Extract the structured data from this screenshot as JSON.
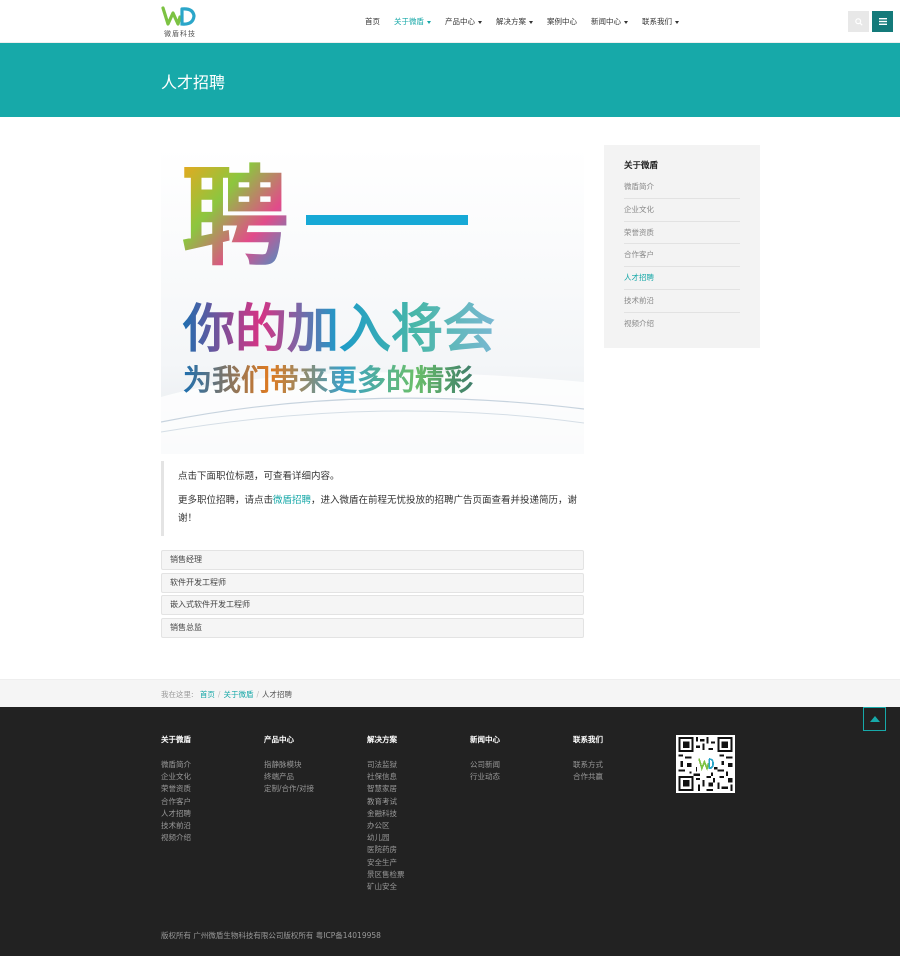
{
  "header": {
    "logo_text": "微盾科技",
    "nav": [
      {
        "label": "首页",
        "active": false,
        "dropdown": false
      },
      {
        "label": "关于微盾",
        "active": true,
        "dropdown": true
      },
      {
        "label": "产品中心",
        "active": false,
        "dropdown": true
      },
      {
        "label": "解决方案",
        "active": false,
        "dropdown": true
      },
      {
        "label": "案例中心",
        "active": false,
        "dropdown": false
      },
      {
        "label": "新闻中心",
        "active": false,
        "dropdown": true
      },
      {
        "label": "联系我们",
        "active": false,
        "dropdown": true
      }
    ],
    "icons": {
      "search": "search-icon",
      "menu": "menu-icon"
    }
  },
  "banner": {
    "title": "人才招聘"
  },
  "recruit_image": {
    "big_char": "聘",
    "line1": "你的加入将会",
    "line2": "为我们带来更多的精彩"
  },
  "intro": {
    "line1": "点击下面职位标题，可查看详细内容。",
    "line2_before": "更多职位招聘，请点击",
    "line2_link": "微盾招聘",
    "line2_after": "，进入微盾在前程无忧投放的招聘广告页面查看并投递简历，谢谢！"
  },
  "jobs": [
    "销售经理",
    "软件开发工程师",
    "嵌入式软件开发工程师",
    "销售总监"
  ],
  "sidebar": {
    "title": "关于微盾",
    "items": [
      {
        "label": "微盾简介",
        "active": false
      },
      {
        "label": "企业文化",
        "active": false
      },
      {
        "label": "荣誉资质",
        "active": false
      },
      {
        "label": "合作客户",
        "active": false
      },
      {
        "label": "人才招聘",
        "active": true
      },
      {
        "label": "技术前沿",
        "active": false
      },
      {
        "label": "视频介绍",
        "active": false
      }
    ]
  },
  "breadcrumb": {
    "prefix": "我在这里:",
    "links": [
      "首页",
      "关于微盾"
    ],
    "current": "人才招聘",
    "separator": "/"
  },
  "footer": {
    "columns": [
      {
        "title": "关于微盾",
        "links": [
          "微盾简介",
          "企业文化",
          "荣誉资质",
          "合作客户",
          "人才招聘",
          "技术前沿",
          "视频介绍"
        ]
      },
      {
        "title": "产品中心",
        "links": [
          "指静脉模块",
          "终端产品",
          "定制/合作/对接"
        ]
      },
      {
        "title": "解决方案",
        "links": [
          "司法监狱",
          "社保信息",
          "智慧家居",
          "教育考试",
          "金融科技",
          "办公区",
          "幼儿园",
          "医院药房",
          "安全生产",
          "景区售检票",
          "矿山安全"
        ]
      },
      {
        "title": "新闻中心",
        "links": [
          "公司新闻",
          "行业动态"
        ]
      },
      {
        "title": "联系我们",
        "links": [
          "联系方式",
          "合作共赢"
        ]
      }
    ],
    "copyright": "版权所有 广州微盾生物科技有限公司版权所有 粤ICP备14019958"
  },
  "colors": {
    "accent": "#17a9a9",
    "footer_bg": "#222222",
    "menu_btn": "#147a7a"
  }
}
